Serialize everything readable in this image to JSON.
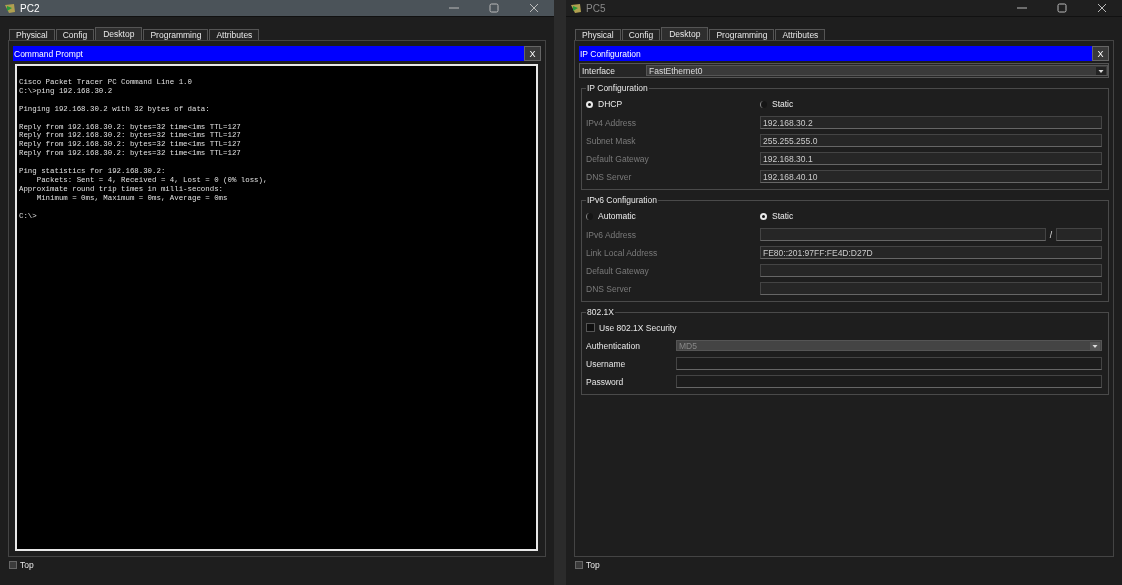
{
  "windows": [
    {
      "title": "PC2",
      "active": true,
      "tabs": [
        {
          "label": "Physical",
          "selected": false
        },
        {
          "label": "Config",
          "selected": false
        },
        {
          "label": "Desktop",
          "selected": true
        },
        {
          "label": "Programming",
          "selected": false
        },
        {
          "label": "Attributes",
          "selected": false
        }
      ],
      "app": {
        "kind": "command_prompt",
        "title": "Command Prompt",
        "close": "X",
        "blocks": [
          [
            "Cisco Packet Tracer PC Command Line 1.0",
            "C:\\>ping 192.168.30.2"
          ],
          [
            "Pinging 192.168.30.2 with 32 bytes of data:"
          ],
          [
            "Reply from 192.168.30.2: bytes=32 time<1ms TTL=127",
            "Reply from 192.168.30.2: bytes=32 time<1ms TTL=127",
            "Reply from 192.168.30.2: bytes=32 time<1ms TTL=127",
            "Reply from 192.168.30.2: bytes=32 time<1ms TTL=127"
          ],
          [
            "Ping statistics for 192.168.30.2:",
            "    Packets: Sent = 4, Received = 4, Lost = 0 (0% loss),",
            "Approximate round trip times in milli-seconds:",
            "    Minimum = 0ms, Maximum = 0ms, Average = 0ms"
          ],
          [
            "C:\\>"
          ]
        ]
      },
      "top": {
        "label": "Top",
        "checked": false
      }
    },
    {
      "title": "PC5",
      "active": false,
      "tabs": [
        {
          "label": "Physical",
          "selected": false
        },
        {
          "label": "Config",
          "selected": false
        },
        {
          "label": "Desktop",
          "selected": true
        },
        {
          "label": "Programming",
          "selected": false
        },
        {
          "label": "Attributes",
          "selected": false
        }
      ],
      "app": {
        "kind": "ip_config",
        "title": "IP Configuration",
        "close": "X",
        "interface": {
          "label": "Interface",
          "value": "FastEthernet0"
        },
        "groups": [
          {
            "title": "IP Configuration",
            "radios": [
              {
                "label": "DHCP",
                "selected": true
              },
              {
                "label": "Static",
                "selected": false
              }
            ],
            "rows": [
              {
                "kind": "text",
                "label": "IPv4 Address",
                "value": "192.168.30.2",
                "disabled": true
              },
              {
                "kind": "text",
                "label": "Subnet Mask",
                "value": "255.255.255.0",
                "disabled": true
              },
              {
                "kind": "text",
                "label": "Default Gateway",
                "value": "192.168.30.1",
                "disabled": true
              },
              {
                "kind": "text",
                "label": "DNS Server",
                "value": "192.168.40.10",
                "disabled": true
              }
            ]
          },
          {
            "title": "IPv6 Configuration",
            "radios": [
              {
                "label": "Automatic",
                "selected": false
              },
              {
                "label": "Static",
                "selected": true
              }
            ],
            "rows": [
              {
                "kind": "prefix",
                "label": "IPv6 Address",
                "separator": "/",
                "disabled": true
              },
              {
                "kind": "text",
                "label": "Link Local Address",
                "value": "FE80::201:97FF:FE4D:D27D",
                "disabled": true
              },
              {
                "kind": "text",
                "label": "Default Gateway",
                "disabled": true
              },
              {
                "kind": "text",
                "label": "DNS Server",
                "disabled": true
              }
            ]
          },
          {
            "title": "802.1X",
            "checkbox": {
              "label": "Use 802.1X Security",
              "checked": false
            },
            "rows": [
              {
                "kind": "select",
                "label": "Authentication",
                "value": "MD5",
                "disabled": false
              },
              {
                "kind": "text",
                "label": "Username",
                "disabled": false
              },
              {
                "kind": "text",
                "label": "Password",
                "disabled": false
              }
            ]
          }
        ]
      },
      "top": {
        "label": "Top",
        "checked": false
      }
    }
  ]
}
